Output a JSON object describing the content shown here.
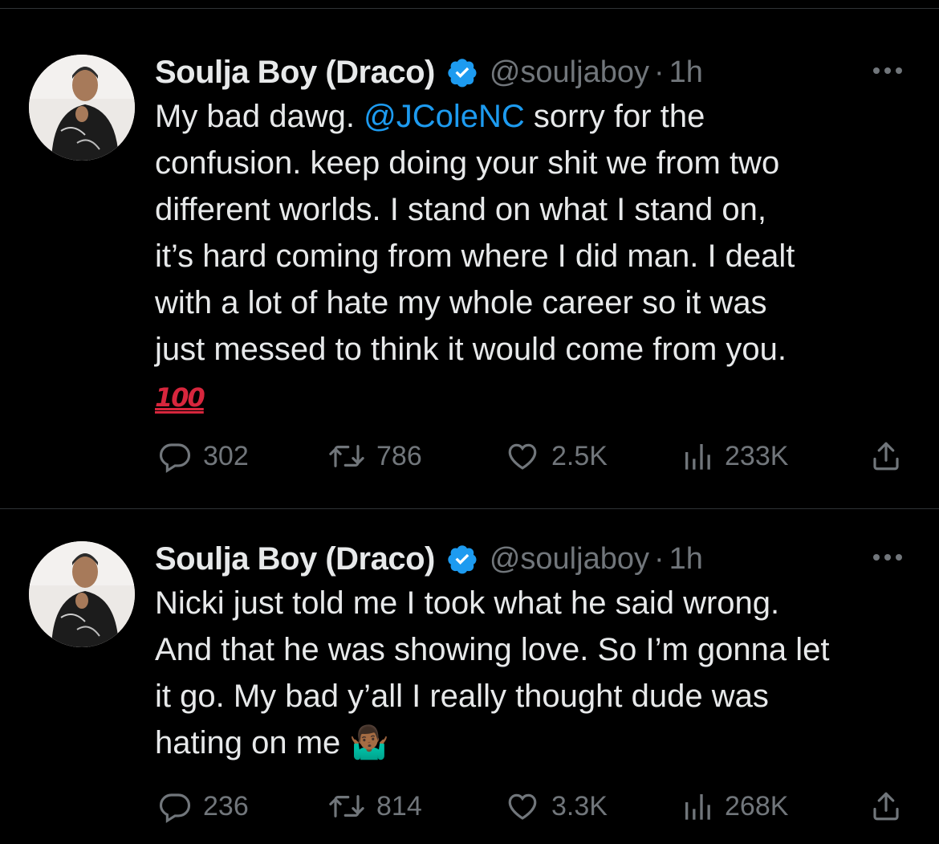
{
  "tweets": [
    {
      "display_name": "Soulja Boy (Draco)",
      "handle": "@souljaboy",
      "separator": "·",
      "time": "1h",
      "verified_icon": "verified-badge-icon",
      "text_before_mention": "My bad dawg. ",
      "mention": "@JColeNC",
      "text_after_mention": " sorry for the\nconfusion. keep doing your shit we from two\ndifferent worlds. I stand on what I stand on,\nit’s hard coming from where I did man. I dealt\nwith a lot of hate my whole career so it was\njust messed to think it would come from you.\n",
      "emoji": "100",
      "stats": {
        "replies": "302",
        "retweets": "786",
        "likes": "2.5K",
        "views": "233K"
      }
    },
    {
      "display_name": "Soulja Boy (Draco)",
      "handle": "@souljaboy",
      "separator": "·",
      "time": "1h",
      "verified_icon": "verified-badge-icon",
      "text": "Nicki just told me I took what he said wrong.\nAnd that he was showing love. So I’m gonna let\nit go. My bad y’all I really thought dude was\nhating on me ",
      "emoji": "🤷🏾‍♂️",
      "stats": {
        "replies": "236",
        "retweets": "814",
        "likes": "3.3K",
        "views": "268K"
      }
    }
  ],
  "colors": {
    "background": "#000000",
    "text": "#e7e9ea",
    "secondary": "#71767b",
    "accent": "#1d9bf0",
    "divider": "#2f3336"
  }
}
